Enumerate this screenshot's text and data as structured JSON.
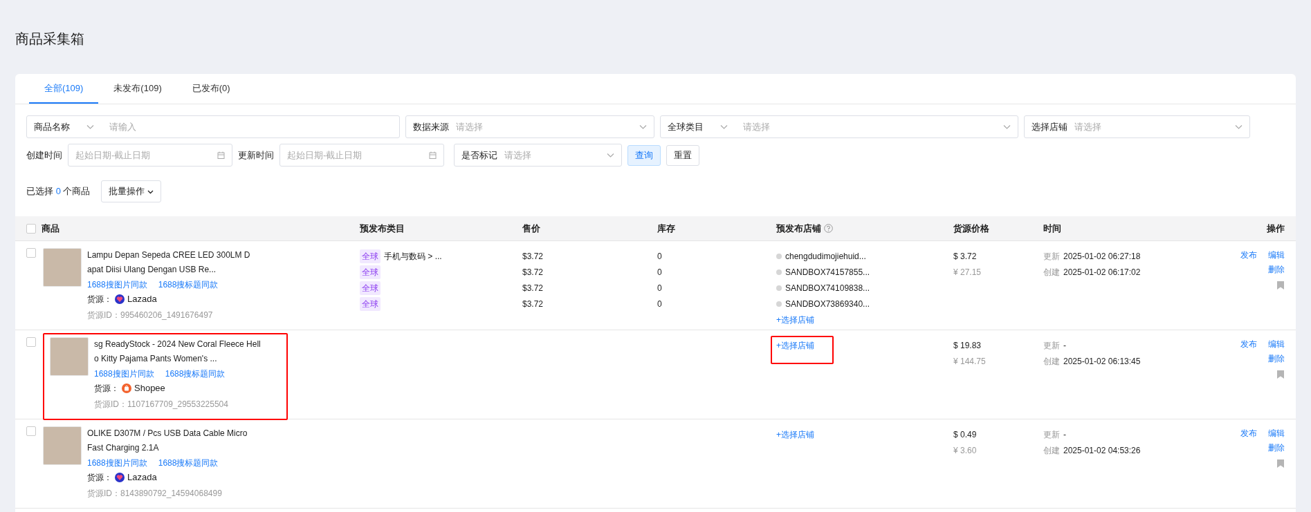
{
  "page_title": "商品采集箱",
  "tabs": [
    {
      "label": "全部(109)",
      "selected": true
    },
    {
      "label": "未发布(109)",
      "selected": false
    },
    {
      "label": "已发布(0)",
      "selected": false
    }
  ],
  "filters": [
    {
      "kind": "select-input",
      "label": "商品名称",
      "placeholder": "请输入"
    },
    {
      "kind": "select",
      "label": "数据来源",
      "placeholder": "请选择"
    },
    {
      "kind": "select-select",
      "label": "全球类目",
      "placeholder": "请选择"
    },
    {
      "kind": "select",
      "label": "选择店铺",
      "placeholder": "请选择"
    }
  ],
  "filters_2": [
    {
      "kind": "date",
      "label": "创建时间",
      "placeholder": "起始日期-截止日期"
    },
    {
      "kind": "date",
      "label": "更新时间",
      "placeholder": "起始日期-截止日期"
    },
    {
      "kind": "select",
      "label": "是否标记",
      "placeholder": "请选择"
    }
  ],
  "buttons": [
    {
      "label": "查询",
      "kind": "primary"
    },
    {
      "label": "重置",
      "kind": "default"
    }
  ],
  "selection": {
    "prefix": "已选择",
    "count": "0",
    "suffix": "个商品"
  },
  "batch_button": "批量操作",
  "table": {
    "select_all": {
      "checked": false
    },
    "columns": [
      "商品",
      "预发布类目",
      "售价",
      "库存",
      "预发布店铺",
      "货源价格",
      "时间",
      "操作"
    ],
    "rows": [
      {
        "checked": false,
        "title": "Lampu Depan Sepeda CREE LED 300LM Dapat Diisi Ulang Dengan USB Re...",
        "links": [
          "1688搜图片同款",
          "1688搜标题同款"
        ],
        "source_label": "货源：",
        "source": {
          "kind": "lazada",
          "name": "Lazada"
        },
        "source_id": "货源ID：995460206_1491676497",
        "variants": [
          {
            "tag": "全球",
            "path": "手机与数码 > ...",
            "price": "$3.72",
            "stock": "0",
            "store": "chengdudimojiehuid..."
          },
          {
            "tag": "全球",
            "price": "$3.72",
            "stock": "0",
            "store": "SANDBOX74157855..."
          },
          {
            "tag": "全球",
            "price": "$3.72",
            "stock": "0",
            "store": "SANDBOX74109838..."
          },
          {
            "tag": "全球",
            "price": "$3.72",
            "stock": "0",
            "store": "SANDBOX73869340..."
          }
        ],
        "add_store": "+选择店铺",
        "source_price": "$ 3.72",
        "source_price_cny": "¥ 27.15",
        "updated_label": "更新",
        "updated": "2025-01-02 06:27:18",
        "created_label": "创建",
        "created": "2025-01-02 06:17:02",
        "actions": [
          "发布",
          "编辑",
          "删除"
        ],
        "marked": false,
        "highlighted": false
      },
      {
        "checked": false,
        "title": "sg ReadyStock - 2024 New Coral Fleece Hello Kitty Pajama Pants Women's ...",
        "links": [
          "1688搜图片同款",
          "1688搜标题同款"
        ],
        "source_label": "货源：",
        "source": {
          "kind": "shopee",
          "name": "Shopee"
        },
        "source_id": "货源ID：1107167709_29553225504",
        "add_store": "+选择店铺",
        "source_price": "$ 19.83",
        "source_price_cny": "¥ 144.75",
        "updated_label": "更新",
        "updated": "-",
        "created_label": "创建",
        "created": "2025-01-02 06:13:45",
        "actions": [
          "发布",
          "编辑",
          "删除"
        ],
        "marked": false,
        "highlighted": true
      },
      {
        "checked": false,
        "title": "OLIKE D307M / Pcs USB Data Cable Micro Fast Charging 2.1A",
        "links": [
          "1688搜图片同款",
          "1688搜标题同款"
        ],
        "source_label": "货源：",
        "source": {
          "kind": "lazada",
          "name": "Lazada"
        },
        "source_id": "货源ID：8143890792_14594068499",
        "add_store": "+选择店铺",
        "source_price": "$ 0.49",
        "source_price_cny": "¥ 3.60",
        "updated_label": "更新",
        "updated": "-",
        "created_label": "创建",
        "created": "2025-01-02 04:53:26",
        "actions": [
          "发布",
          "编辑",
          "删除"
        ],
        "marked": false,
        "highlighted": false
      }
    ]
  }
}
